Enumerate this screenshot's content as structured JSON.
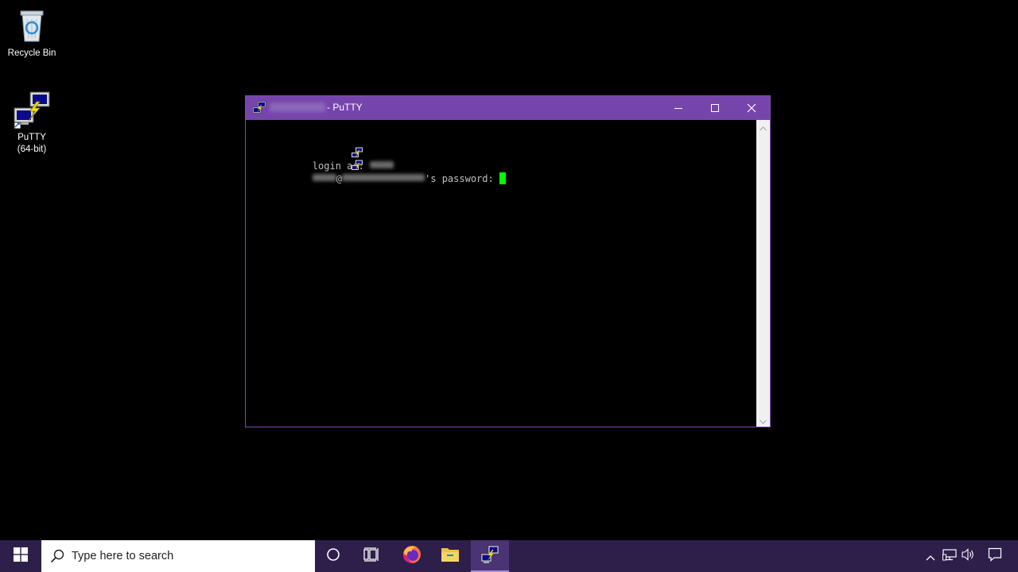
{
  "desktop": {
    "icons": [
      {
        "label": "Recycle Bin",
        "icon": "recycle-bin-icon"
      },
      {
        "label": "PuTTY\n(64-bit)",
        "icon": "putty-icon"
      }
    ]
  },
  "window": {
    "title_suffix": "- PuTTY",
    "icon": "putty-icon",
    "controls": {
      "minimize": "minimize-icon",
      "maximize": "maximize-icon",
      "close": "close-icon"
    }
  },
  "terminal": {
    "line1_prompt": "login as: ",
    "line2_at": "@",
    "line2_suffix": "'s password: ",
    "text_color": "#c0c0c0",
    "cursor_color": "#00ff00"
  },
  "taskbar": {
    "search_placeholder": "Type here to search",
    "apps": [
      "cortana-icon",
      "task-view-icon",
      "firefox-icon",
      "file-explorer-icon",
      "putty-icon"
    ],
    "tray": [
      "chevron-up-icon",
      "network-icon",
      "volume-icon",
      "notifications-icon"
    ],
    "accent": "#7645ac"
  }
}
